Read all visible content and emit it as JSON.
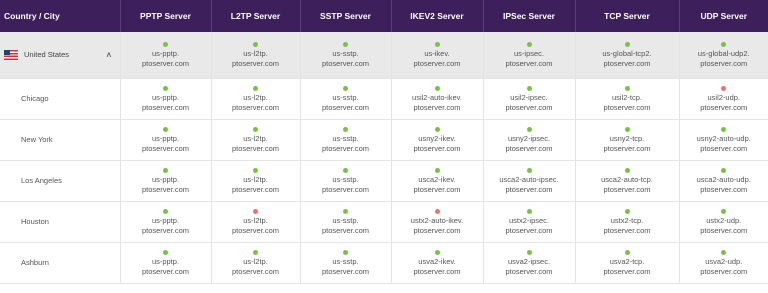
{
  "header": {
    "col0": "Country / City",
    "servers": [
      "PPTP Server",
      "L2TP Server",
      "SSTP Server",
      "IKEV2 Server",
      "IPSec Server",
      "TCP Server",
      "UDP Server"
    ]
  },
  "country": {
    "name": "United States",
    "cells": [
      {
        "host": "us-pptp.",
        "domain": "ptoserver.com",
        "status": "up"
      },
      {
        "host": "us-l2tp.",
        "domain": "ptoserver.com",
        "status": "up"
      },
      {
        "host": "us-sstp.",
        "domain": "ptoserver.com",
        "status": "up"
      },
      {
        "host": "us-ikev.",
        "domain": "ptoserver.com",
        "status": "up"
      },
      {
        "host": "us-ipsec.",
        "domain": "ptoserver.com",
        "status": "up"
      },
      {
        "host": "us-global-tcp2.",
        "domain": "ptoserver.com",
        "status": "up"
      },
      {
        "host": "us-global-udp2.",
        "domain": "ptoserver.com",
        "status": "up"
      }
    ]
  },
  "cities": [
    {
      "name": "Chicago",
      "cells": [
        {
          "host": "us-pptp.",
          "domain": "ptoserver.com",
          "status": "up"
        },
        {
          "host": "us-l2tp.",
          "domain": "ptoserver.com",
          "status": "up"
        },
        {
          "host": "us-sstp.",
          "domain": "ptoserver.com",
          "status": "up"
        },
        {
          "host": "usil2-auto-ikev.",
          "domain": "ptoserver.com",
          "status": "up"
        },
        {
          "host": "usil2-ipsec.",
          "domain": "ptoserver.com",
          "status": "up"
        },
        {
          "host": "usil2-tcp.",
          "domain": "ptoserver.com",
          "status": "up"
        },
        {
          "host": "usil2-udp.",
          "domain": "ptoserver.com",
          "status": "down"
        }
      ]
    },
    {
      "name": "New York",
      "cells": [
        {
          "host": "us-pptp.",
          "domain": "ptoserver.com",
          "status": "up"
        },
        {
          "host": "us-l2tp.",
          "domain": "ptoserver.com",
          "status": "up"
        },
        {
          "host": "us-sstp.",
          "domain": "ptoserver.com",
          "status": "up"
        },
        {
          "host": "usny2-ikev.",
          "domain": "ptoserver.com",
          "status": "up"
        },
        {
          "host": "usny2-ipsec.",
          "domain": "ptoserver.com",
          "status": "up"
        },
        {
          "host": "usny2-tcp.",
          "domain": "ptoserver.com",
          "status": "up"
        },
        {
          "host": "usny2-auto-udp.",
          "domain": "ptoserver.com",
          "status": "up"
        }
      ]
    },
    {
      "name": "Los Angeles",
      "cells": [
        {
          "host": "us-pptp.",
          "domain": "ptoserver.com",
          "status": "up"
        },
        {
          "host": "us-l2tp.",
          "domain": "ptoserver.com",
          "status": "up"
        },
        {
          "host": "us-sstp.",
          "domain": "ptoserver.com",
          "status": "up"
        },
        {
          "host": "usca2-ikev.",
          "domain": "ptoserver.com",
          "status": "up"
        },
        {
          "host": "usca2-auto-ipsec.",
          "domain": "ptoserver.com",
          "status": "up"
        },
        {
          "host": "usca2-auto-tcp.",
          "domain": "ptoserver.com",
          "status": "up"
        },
        {
          "host": "usca2-auto-udp.",
          "domain": "ptoserver.com",
          "status": "up"
        }
      ]
    },
    {
      "name": "Houston",
      "cells": [
        {
          "host": "us-pptp.",
          "domain": "ptoserver.com",
          "status": "up"
        },
        {
          "host": "us-l2tp.",
          "domain": "ptoserver.com",
          "status": "down"
        },
        {
          "host": "us-sstp.",
          "domain": "ptoserver.com",
          "status": "up"
        },
        {
          "host": "ustx2-auto-ikev.",
          "domain": "ptoserver.com",
          "status": "down"
        },
        {
          "host": "ustx2-ipsec.",
          "domain": "ptoserver.com",
          "status": "up"
        },
        {
          "host": "ustx2-tcp.",
          "domain": "ptoserver.com",
          "status": "up"
        },
        {
          "host": "ustx2-udp.",
          "domain": "ptoserver.com",
          "status": "up"
        }
      ]
    },
    {
      "name": "Ashburn",
      "cells": [
        {
          "host": "us-pptp.",
          "domain": "ptoserver.com",
          "status": "up"
        },
        {
          "host": "us-l2tp.",
          "domain": "ptoserver.com",
          "status": "up"
        },
        {
          "host": "us-sstp.",
          "domain": "ptoserver.com",
          "status": "up"
        },
        {
          "host": "usva2-ikev.",
          "domain": "ptoserver.com",
          "status": "up"
        },
        {
          "host": "usva2-ipsec.",
          "domain": "ptoserver.com",
          "status": "up"
        },
        {
          "host": "usva2-tcp.",
          "domain": "ptoserver.com",
          "status": "up"
        },
        {
          "host": "usva2-udp.",
          "domain": "ptoserver.com",
          "status": "up"
        }
      ]
    }
  ],
  "colors": {
    "header_bg": "#3d1f5b",
    "status_up": "#7ac143",
    "status_down": "#ef6f6f",
    "country_row_bg": "#e9e9e9"
  },
  "icons": {
    "flag": "us-flag-icon",
    "expand": "chevron-up-icon"
  }
}
